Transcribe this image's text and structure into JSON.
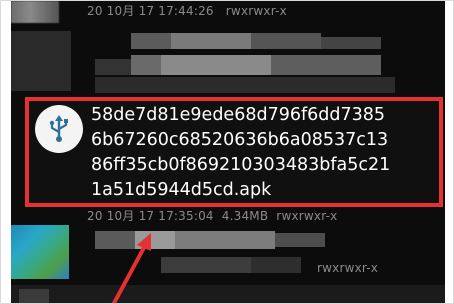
{
  "items": [
    {
      "meta": "20 10月 17 17:44:26   rwxrwxr-x"
    },
    {
      "filename_lines": [
        "58de7d81e9ede68d796f6dd7385",
        "6b67260c68520636b6a08537c13",
        "86ff35cb0f869210303483bfa5c21",
        "1a51d5944d5cd.apk"
      ],
      "meta": "20 10月 17 17:35:04  4.34MB  rwxrwxr-x"
    },
    {
      "meta": "rwxrwxr-x"
    }
  ],
  "icons": {
    "highlighted_item": "usb-icon"
  },
  "colors": {
    "highlight_border": "#e53131",
    "arrow": "#e53131",
    "background": "#0c0c0c"
  }
}
